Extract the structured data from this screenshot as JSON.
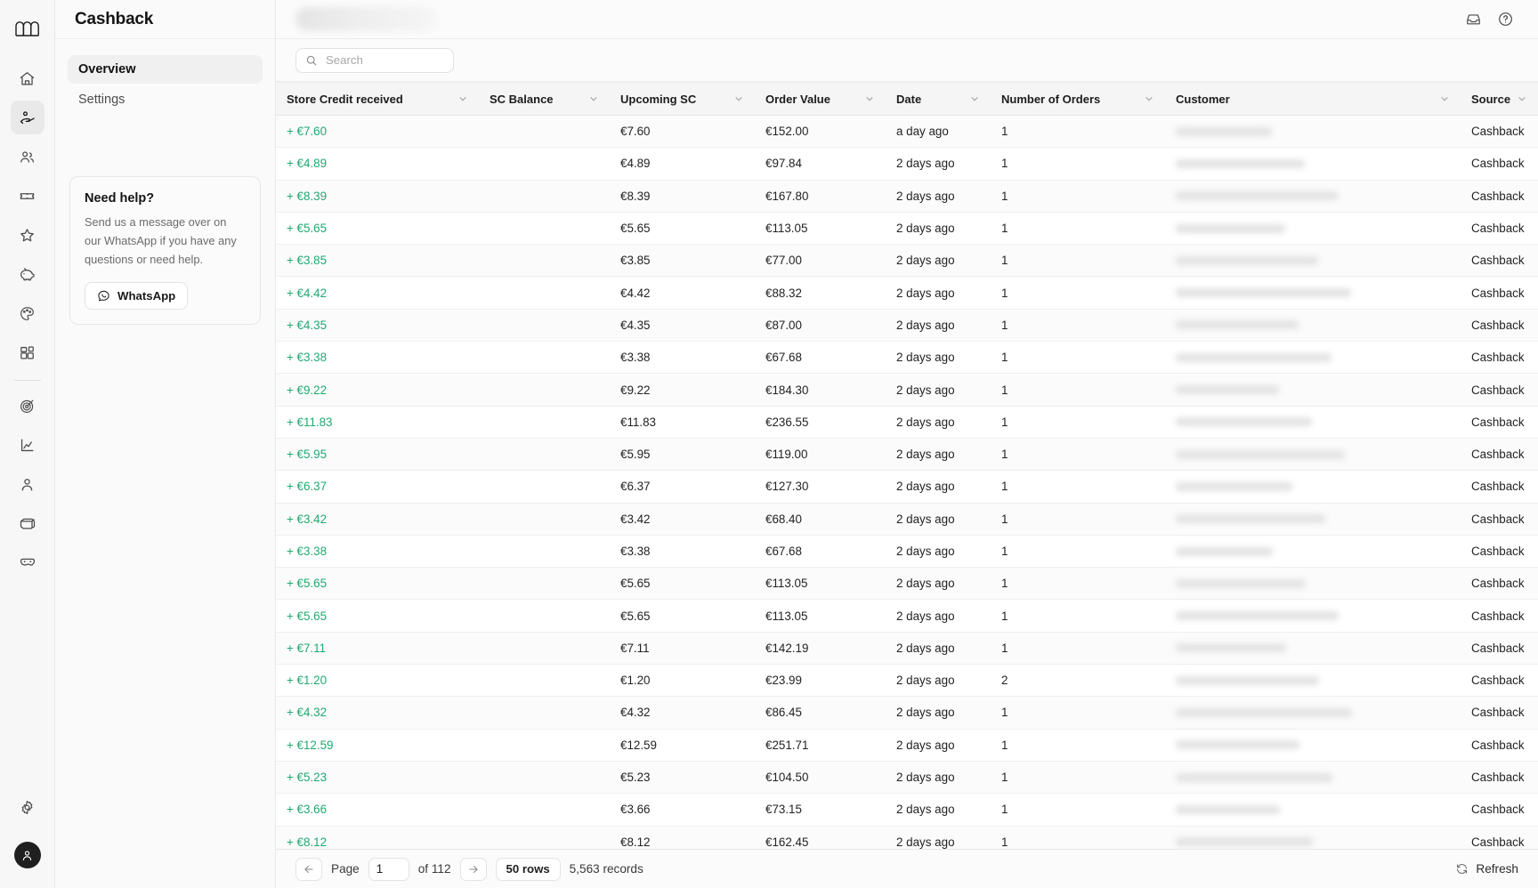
{
  "rail": {
    "logo_icon": "brand-logo-icon",
    "items": [
      {
        "icon": "home-icon",
        "name": "home",
        "active": false
      },
      {
        "icon": "hand-coin-icon",
        "name": "cashback",
        "active": true
      },
      {
        "icon": "people-icon",
        "name": "customers",
        "active": false
      },
      {
        "icon": "ticket-icon",
        "name": "coupons",
        "active": false
      },
      {
        "icon": "star-icon",
        "name": "reviews",
        "active": false
      },
      {
        "icon": "piggy-bank-icon",
        "name": "savings",
        "active": false
      },
      {
        "icon": "palette-icon",
        "name": "branding",
        "active": false
      },
      {
        "icon": "blocks-icon",
        "name": "widgets",
        "active": false
      },
      {
        "icon": "target-icon",
        "name": "campaigns",
        "active": false,
        "after_divider": true
      },
      {
        "icon": "analytics-icon",
        "name": "analytics",
        "active": false
      },
      {
        "icon": "person-icon",
        "name": "segments",
        "active": false
      },
      {
        "icon": "box-icon",
        "name": "products",
        "active": false
      },
      {
        "icon": "mask-icon",
        "name": "integrations",
        "active": false
      }
    ],
    "gear_icon": "gear-icon",
    "avatar_icon": "user-avatar-icon"
  },
  "sidebar": {
    "title": "Cashback",
    "nav": [
      {
        "label": "Overview",
        "active": true
      },
      {
        "label": "Settings",
        "active": false
      }
    ],
    "help": {
      "title": "Need help?",
      "body": "Send us a message over on our WhatsApp if you have any questions or need help.",
      "button_label": "WhatsApp",
      "button_icon": "whatsapp-chat-icon"
    }
  },
  "topbar": {
    "redacted_pill": "",
    "inbox_icon": "inbox-icon",
    "help_icon": "help-circle-icon"
  },
  "search": {
    "icon": "search-icon",
    "placeholder": "Search",
    "value": ""
  },
  "table": {
    "columns": [
      {
        "label": "Store Credit received",
        "sortable": true
      },
      {
        "label": "SC Balance",
        "sortable": true
      },
      {
        "label": "Upcoming SC",
        "sortable": true
      },
      {
        "label": "Order Value",
        "sortable": true
      },
      {
        "label": "Date",
        "sortable": true
      },
      {
        "label": "Number of Orders",
        "sortable": true
      },
      {
        "label": "Customer",
        "sortable": true
      },
      {
        "label": "Source",
        "sortable": true
      }
    ],
    "rows": [
      {
        "credit": "+ €7.60",
        "sc_balance": "",
        "upcoming": "€7.60",
        "order_value": "€152.00",
        "date": "a day ago",
        "orders": "1",
        "customer": "",
        "source": "Cashback"
      },
      {
        "credit": "+ €4.89",
        "sc_balance": "",
        "upcoming": "€4.89",
        "order_value": "€97.84",
        "date": "2 days ago",
        "orders": "1",
        "customer": "",
        "source": "Cashback"
      },
      {
        "credit": "+ €8.39",
        "sc_balance": "",
        "upcoming": "€8.39",
        "order_value": "€167.80",
        "date": "2 days ago",
        "orders": "1",
        "customer": "",
        "source": "Cashback"
      },
      {
        "credit": "+ €5.65",
        "sc_balance": "",
        "upcoming": "€5.65",
        "order_value": "€113.05",
        "date": "2 days ago",
        "orders": "1",
        "customer": "",
        "source": "Cashback"
      },
      {
        "credit": "+ €3.85",
        "sc_balance": "",
        "upcoming": "€3.85",
        "order_value": "€77.00",
        "date": "2 days ago",
        "orders": "1",
        "customer": "",
        "source": "Cashback"
      },
      {
        "credit": "+ €4.42",
        "sc_balance": "",
        "upcoming": "€4.42",
        "order_value": "€88.32",
        "date": "2 days ago",
        "orders": "1",
        "customer": "",
        "source": "Cashback"
      },
      {
        "credit": "+ €4.35",
        "sc_balance": "",
        "upcoming": "€4.35",
        "order_value": "€87.00",
        "date": "2 days ago",
        "orders": "1",
        "customer": "",
        "source": "Cashback"
      },
      {
        "credit": "+ €3.38",
        "sc_balance": "",
        "upcoming": "€3.38",
        "order_value": "€67.68",
        "date": "2 days ago",
        "orders": "1",
        "customer": "",
        "source": "Cashback"
      },
      {
        "credit": "+ €9.22",
        "sc_balance": "",
        "upcoming": "€9.22",
        "order_value": "€184.30",
        "date": "2 days ago",
        "orders": "1",
        "customer": "",
        "source": "Cashback"
      },
      {
        "credit": "+ €11.83",
        "sc_balance": "",
        "upcoming": "€11.83",
        "order_value": "€236.55",
        "date": "2 days ago",
        "orders": "1",
        "customer": "",
        "source": "Cashback"
      },
      {
        "credit": "+ €5.95",
        "sc_balance": "",
        "upcoming": "€5.95",
        "order_value": "€119.00",
        "date": "2 days ago",
        "orders": "1",
        "customer": "",
        "source": "Cashback"
      },
      {
        "credit": "+ €6.37",
        "sc_balance": "",
        "upcoming": "€6.37",
        "order_value": "€127.30",
        "date": "2 days ago",
        "orders": "1",
        "customer": "",
        "source": "Cashback"
      },
      {
        "credit": "+ €3.42",
        "sc_balance": "",
        "upcoming": "€3.42",
        "order_value": "€68.40",
        "date": "2 days ago",
        "orders": "1",
        "customer": "",
        "source": "Cashback"
      },
      {
        "credit": "+ €3.38",
        "sc_balance": "",
        "upcoming": "€3.38",
        "order_value": "€67.68",
        "date": "2 days ago",
        "orders": "1",
        "customer": "",
        "source": "Cashback"
      },
      {
        "credit": "+ €5.65",
        "sc_balance": "",
        "upcoming": "€5.65",
        "order_value": "€113.05",
        "date": "2 days ago",
        "orders": "1",
        "customer": "",
        "source": "Cashback"
      },
      {
        "credit": "+ €5.65",
        "sc_balance": "",
        "upcoming": "€5.65",
        "order_value": "€113.05",
        "date": "2 days ago",
        "orders": "1",
        "customer": "",
        "source": "Cashback"
      },
      {
        "credit": "+ €7.11",
        "sc_balance": "",
        "upcoming": "€7.11",
        "order_value": "€142.19",
        "date": "2 days ago",
        "orders": "1",
        "customer": "",
        "source": "Cashback"
      },
      {
        "credit": "+ €1.20",
        "sc_balance": "",
        "upcoming": "€1.20",
        "order_value": "€23.99",
        "date": "2 days ago",
        "orders": "2",
        "customer": "",
        "source": "Cashback"
      },
      {
        "credit": "+ €4.32",
        "sc_balance": "",
        "upcoming": "€4.32",
        "order_value": "€86.45",
        "date": "2 days ago",
        "orders": "1",
        "customer": "",
        "source": "Cashback"
      },
      {
        "credit": "+ €12.59",
        "sc_balance": "",
        "upcoming": "€12.59",
        "order_value": "€251.71",
        "date": "2 days ago",
        "orders": "1",
        "customer": "",
        "source": "Cashback"
      },
      {
        "credit": "+ €5.23",
        "sc_balance": "",
        "upcoming": "€5.23",
        "order_value": "€104.50",
        "date": "2 days ago",
        "orders": "1",
        "customer": "",
        "source": "Cashback"
      },
      {
        "credit": "+ €3.66",
        "sc_balance": "",
        "upcoming": "€3.66",
        "order_value": "€73.15",
        "date": "2 days ago",
        "orders": "1",
        "customer": "",
        "source": "Cashback"
      },
      {
        "credit": "+ €8.12",
        "sc_balance": "",
        "upcoming": "€8.12",
        "order_value": "€162.45",
        "date": "2 days ago",
        "orders": "1",
        "customer": "",
        "source": "Cashback"
      }
    ]
  },
  "footer": {
    "prev_icon": "arrow-left-icon",
    "next_icon": "arrow-right-icon",
    "page_label": "Page",
    "page_value": "1",
    "of_label": "of 112",
    "rows_label": "50 rows",
    "records_label": "5,563 records",
    "refresh_label": "Refresh",
    "refresh_icon": "refresh-icon"
  },
  "colors": {
    "credit_green": "#1fa971",
    "active_nav_bg": "#f0f0f0",
    "header_bg": "#f5f5f5"
  }
}
